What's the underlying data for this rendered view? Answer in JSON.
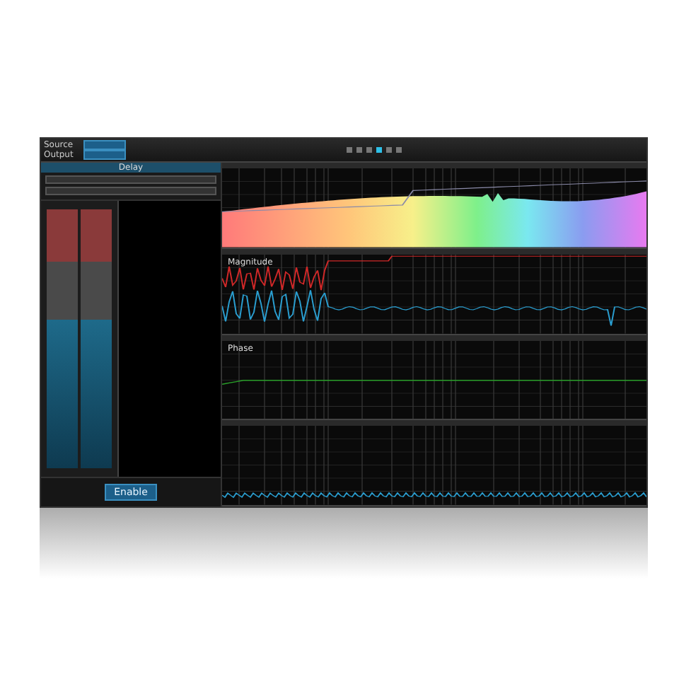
{
  "inputs": [
    {
      "label": "Source"
    },
    {
      "label": "Output"
    }
  ],
  "delay_panel": {
    "title": "Delay"
  },
  "controls": {
    "button": "Enable"
  },
  "plots": [
    {
      "kind": "spectrum"
    },
    {
      "kind": "magnitude",
      "title": "Magnitude"
    },
    {
      "kind": "phase",
      "title": "Phase"
    },
    {
      "kind": "impulse"
    }
  ]
}
